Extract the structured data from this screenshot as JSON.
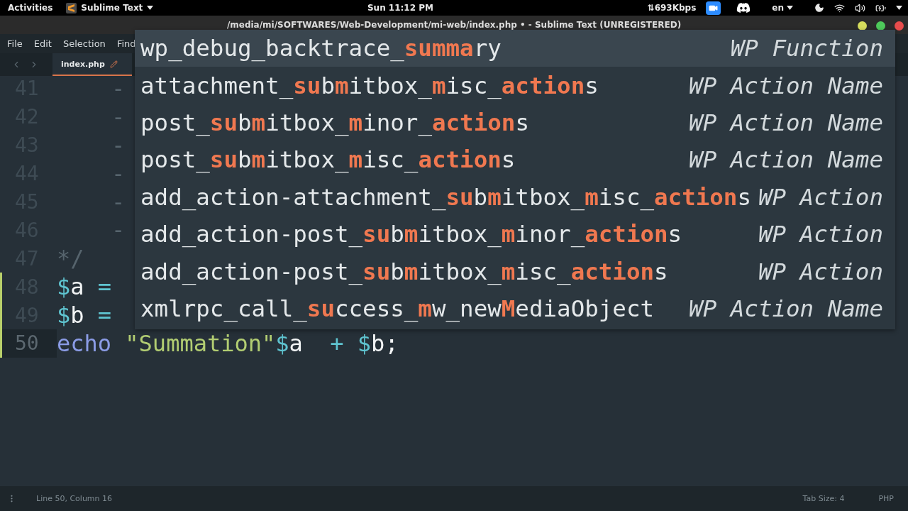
{
  "top_bar": {
    "activities": "Activities",
    "app_name": "Sublime Text",
    "clock": "Sun 11:12 PM",
    "network_speed": "⇅693Kbps",
    "language": "en"
  },
  "window": {
    "title": "/media/mi/SOFTWARES/Web-Development/mi-web/index.php • - Sublime Text (UNREGISTERED)"
  },
  "menu": [
    "File",
    "Edit",
    "Selection",
    "Find"
  ],
  "tabs": [
    {
      "label": "index.php",
      "selected": true,
      "modified": true
    }
  ],
  "editor": {
    "lines": [
      {
        "number": "41",
        "current": false,
        "modified": false,
        "tokens": [
          {
            "kind": "comment",
            "text": "    -"
          }
        ]
      },
      {
        "number": "42",
        "current": false,
        "modified": false,
        "tokens": [
          {
            "kind": "comment",
            "text": "    -"
          }
        ]
      },
      {
        "number": "43",
        "current": false,
        "modified": false,
        "tokens": [
          {
            "kind": "comment",
            "text": "    -"
          }
        ]
      },
      {
        "number": "44",
        "current": false,
        "modified": false,
        "tokens": [
          {
            "kind": "comment",
            "text": "    -"
          }
        ]
      },
      {
        "number": "45",
        "current": false,
        "modified": false,
        "tokens": [
          {
            "kind": "comment",
            "text": "    -"
          }
        ]
      },
      {
        "number": "46",
        "current": false,
        "modified": false,
        "tokens": [
          {
            "kind": "comment",
            "text": "    -"
          }
        ]
      },
      {
        "number": "47",
        "current": false,
        "modified": false,
        "tokens": [
          {
            "kind": "comment",
            "text": "*/"
          }
        ]
      },
      {
        "number": "48",
        "current": false,
        "modified": true,
        "tokens": [
          {
            "kind": "sigil",
            "text": "$"
          },
          {
            "kind": "ident",
            "text": "a"
          },
          {
            "kind": "operator",
            "text": " ="
          }
        ]
      },
      {
        "number": "49",
        "current": false,
        "modified": true,
        "tokens": [
          {
            "kind": "sigil",
            "text": "$"
          },
          {
            "kind": "ident",
            "text": "b"
          },
          {
            "kind": "operator",
            "text": " ="
          }
        ]
      },
      {
        "number": "50",
        "current": true,
        "modified": true,
        "tokens": [
          {
            "kind": "keyword",
            "text": "echo"
          },
          {
            "kind": "string",
            "text": " \"Summation\""
          },
          {
            "kind": "sigil",
            "text": "$"
          },
          {
            "kind": "ident",
            "text": "a"
          },
          {
            "kind": "operator",
            "text": "  +"
          },
          {
            "kind": "sigil",
            "text": " $"
          },
          {
            "kind": "ident",
            "text": "b"
          },
          {
            "kind": "ident",
            "text": ";"
          }
        ]
      }
    ]
  },
  "autocomplete": [
    {
      "name": "wp_debug_backtrace_**summa**ry",
      "type": "WP Function",
      "selected": true
    },
    {
      "name": "attachment_**su**b**m**itbox_**m**isc_**action**s",
      "type": "WP Action Name",
      "selected": false
    },
    {
      "name": "post_**su**b**m**itbox_**m**inor_**action**s",
      "type": "WP Action Name",
      "selected": false
    },
    {
      "name": "post_**su**b**m**itbox_**m**isc_**action**s",
      "type": "WP Action Name",
      "selected": false
    },
    {
      "name": "add_action-attachment_**su**b**m**itbox_**m**isc_**action**s",
      "type": "WP Action",
      "selected": false
    },
    {
      "name": "add_action-post_**su**b**m**itbox_**m**inor_**action**s",
      "type": "WP Action",
      "selected": false
    },
    {
      "name": "add_action-post_**su**b**m**itbox_**m**isc_**action**s",
      "type": "WP Action",
      "selected": false
    },
    {
      "name": "xmlrpc_call_**su**ccess_**m**w_new**M**ediaObject",
      "type": "WP Action Name",
      "selected": false
    }
  ],
  "status_bar": {
    "position": "Line 50, Column 16",
    "tab_size": "Tab Size: 4",
    "syntax": "PHP"
  }
}
